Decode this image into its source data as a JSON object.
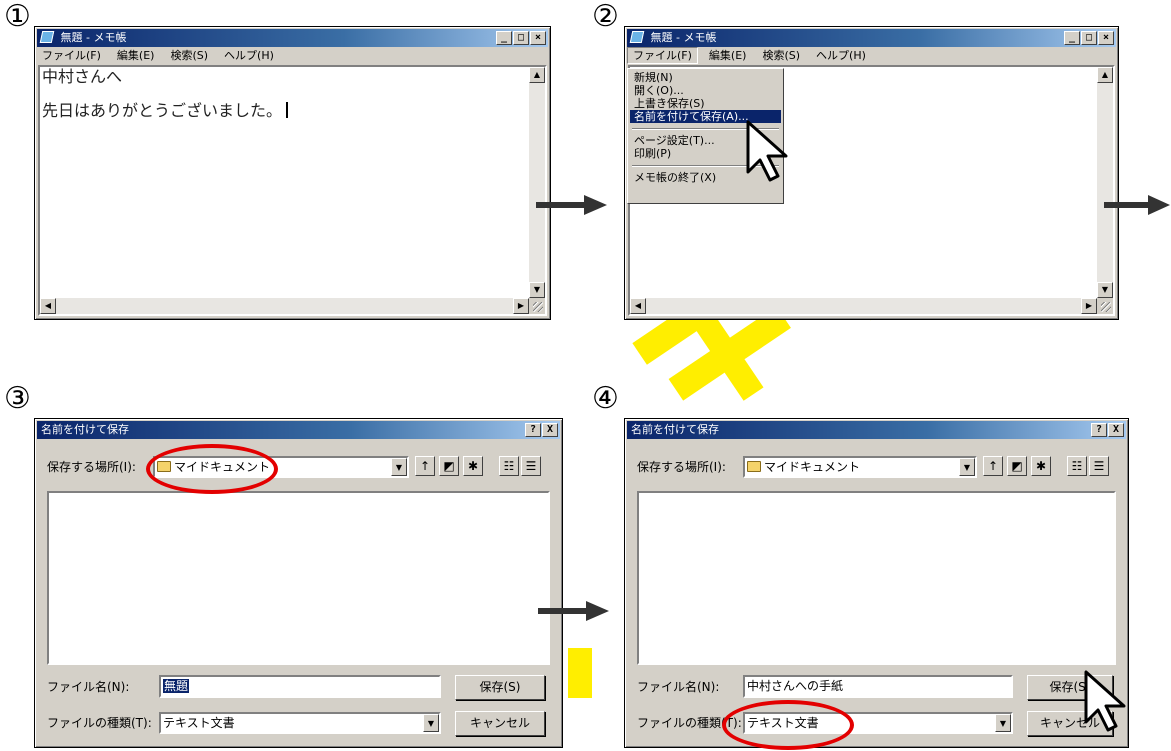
{
  "steps": [
    "①",
    "②",
    "③",
    "④"
  ],
  "notepad": {
    "title": "無題 - メモ帳",
    "menu": [
      "ファイル(F)",
      "編集(E)",
      "検索(S)",
      "ヘルプ(H)"
    ],
    "lines": [
      "中村さんへ",
      "先日はありがとうございました。"
    ]
  },
  "file_menu": {
    "items": [
      "新規(N)",
      "開く(O)...",
      "上書き保存(S)",
      "名前を付けて保存(A)...",
      "ページ設定(T)...",
      "印刷(P)",
      "メモ帳の終了(X)"
    ],
    "selected_index": 3
  },
  "save_dialog": {
    "title": "名前を付けて保存",
    "help_button": "?",
    "close_button": "X",
    "location_label": "保存する場所(I):",
    "location_value": "マイドキュメント",
    "filename_label": "ファイル名(N):",
    "filetype_label": "ファイルの種類(T):",
    "filetype_value": "テキスト文書",
    "save_button": "保存(S)",
    "cancel_button": "キャンセル",
    "step3_filename": "無題",
    "step4_filename": "中村さんへの手紙"
  },
  "colors": {
    "titlebar_start": "#0a246a",
    "highlight_ellipse": "#e30000",
    "watermark": "#ffee00"
  }
}
